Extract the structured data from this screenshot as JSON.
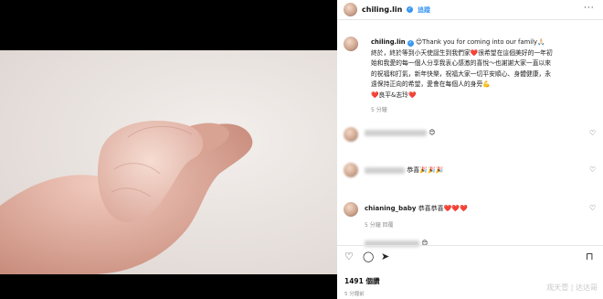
{
  "post": {
    "username": "chiling.lin",
    "follow_label": "追蹤",
    "more_label": "···"
  },
  "caption": {
    "username": "chiling.lin",
    "line1": "😊Thank you for coming into our family🙏🏻",
    "line2": "終於，終於等到小天使誕生到我們家❤️很希望在這個美好的一年初",
    "line3": "始和我愛的每一個人分享我衷心感激的喜悅～也謝謝大家一直以來",
    "line4": "的祝福和打氣，新年快樂，祝福大家一切平安順心、身體健康，永",
    "line5": "遠保持正向的希望，愛會在每個人的身旁💪",
    "line6": "❤️良平&志玲❤️",
    "time": "5 分鐘"
  },
  "comments": [
    {
      "text": "😊",
      "meta": ""
    },
    {
      "text": "恭喜🎉🎉🎉",
      "meta": ""
    },
    {
      "username": "chianing_baby",
      "text": "恭喜恭喜❤️❤️❤️",
      "meta": "5 分鐘   回覆"
    },
    {
      "text": "😊",
      "meta": ""
    }
  ],
  "stats": {
    "likes": "1491 個讚",
    "time_ago": "5 分鐘前"
  },
  "watermark": "观天壹 | 达达哥",
  "icons": [
    "heart-icon",
    "comment-icon",
    "share-icon",
    "bookmark-icon",
    "verified-icon",
    "more-icon"
  ],
  "colors": {
    "link": "#3897f0",
    "verified": "#3897f0",
    "meta": "#8e8e8e"
  }
}
